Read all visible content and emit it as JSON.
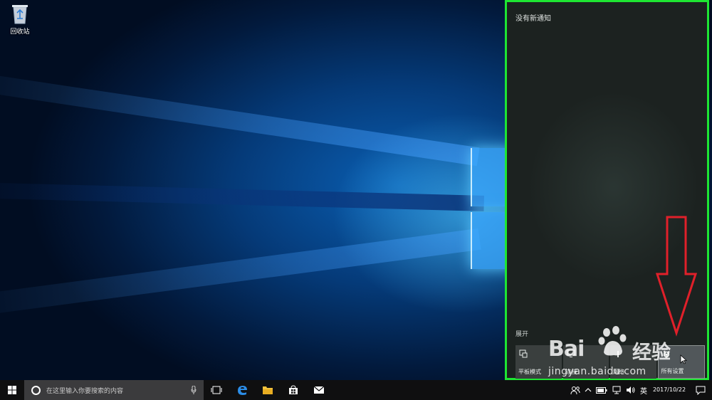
{
  "desktop": {
    "icons": [
      {
        "label": "回收站",
        "icon": "recycle-bin-icon"
      }
    ]
  },
  "action_center": {
    "header": "没有新通知",
    "expand_label": "展开",
    "quick_actions": [
      {
        "label": "平板模式",
        "icon": "tablet-mode-icon"
      },
      {
        "label": "连接",
        "icon": "connect-icon"
      },
      {
        "label": "网络",
        "icon": "network-icon"
      },
      {
        "label": "所有设置",
        "icon": "settings-icon"
      }
    ],
    "highlight_color": "#1ee632",
    "annotation_arrow_color": "#e0202a"
  },
  "watermark": {
    "logo_text": "Bai",
    "brand_text": "经验",
    "url": "jingyan.baidu.com"
  },
  "taskbar": {
    "search_placeholder": "在这里输入你要搜索的内容",
    "pinned": [
      {
        "name": "task-view-icon"
      },
      {
        "name": "edge-icon"
      },
      {
        "name": "file-explorer-icon"
      },
      {
        "name": "store-icon"
      },
      {
        "name": "mail-icon"
      }
    ],
    "tray": {
      "ime": "英",
      "date": "2017/10/22"
    }
  }
}
